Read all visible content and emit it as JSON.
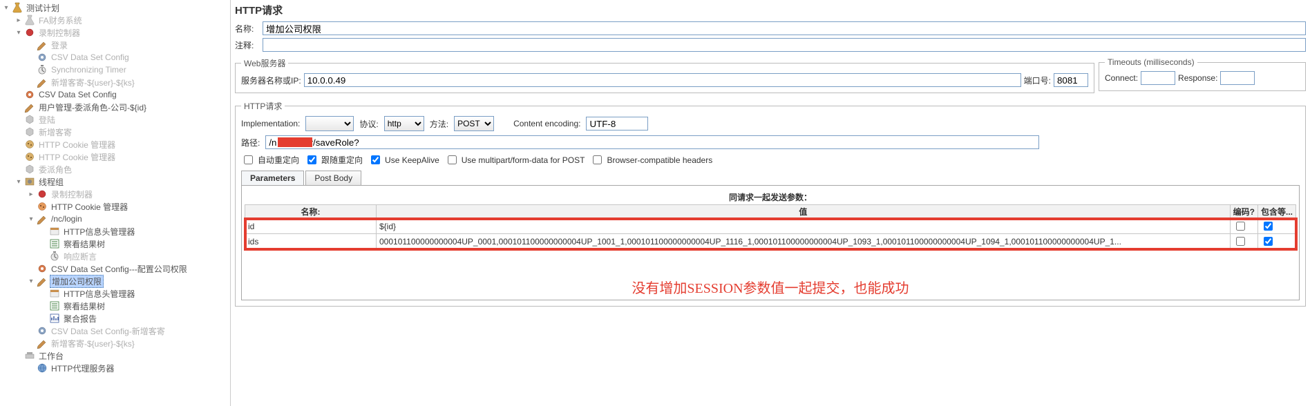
{
  "tree": {
    "items": [
      {
        "ind": 0,
        "toggle": "▾",
        "icon": "flask",
        "label": "测试计划",
        "grey": false
      },
      {
        "ind": 1,
        "toggle": "▸",
        "icon": "flask-grey",
        "label": "FA财务系统",
        "grey": true
      },
      {
        "ind": 1,
        "toggle": "▾",
        "icon": "rec",
        "label": "录制控制器",
        "grey": true
      },
      {
        "ind": 2,
        "toggle": "",
        "icon": "pencil",
        "label": "登录",
        "grey": true
      },
      {
        "ind": 2,
        "toggle": "",
        "icon": "gear",
        "label": "CSV Data Set Config",
        "grey": true
      },
      {
        "ind": 2,
        "toggle": "",
        "icon": "timer",
        "label": "Synchronizing Timer",
        "grey": true
      },
      {
        "ind": 2,
        "toggle": "",
        "icon": "pencil",
        "label": "新增客寄-${user}-${ks}",
        "grey": true
      },
      {
        "ind": 1,
        "toggle": "",
        "icon": "gear-red",
        "label": "CSV Data Set Config",
        "grey": false
      },
      {
        "ind": 1,
        "toggle": "",
        "icon": "pencil",
        "label": "用户管理-委派角色-公司-${id}",
        "grey": false
      },
      {
        "ind": 1,
        "toggle": "",
        "icon": "cube",
        "label": "登陆",
        "grey": true
      },
      {
        "ind": 1,
        "toggle": "",
        "icon": "cube",
        "label": "新增客寄",
        "grey": true
      },
      {
        "ind": 1,
        "toggle": "",
        "icon": "cookie",
        "label": "HTTP Cookie 管理器",
        "grey": true
      },
      {
        "ind": 1,
        "toggle": "",
        "icon": "cookie",
        "label": "HTTP Cookie 管理器",
        "grey": true
      },
      {
        "ind": 1,
        "toggle": "",
        "icon": "cube",
        "label": "委派角色",
        "grey": true
      },
      {
        "ind": 1,
        "toggle": "▾",
        "icon": "threads",
        "label": "线程组",
        "grey": false
      },
      {
        "ind": 2,
        "toggle": "▸",
        "icon": "rec",
        "label": "录制控制器",
        "grey": true
      },
      {
        "ind": 2,
        "toggle": "",
        "icon": "cookie-red",
        "label": "HTTP Cookie 管理器",
        "grey": false
      },
      {
        "ind": 2,
        "toggle": "▾",
        "icon": "pencil",
        "label": "/nc/login",
        "grey": false
      },
      {
        "ind": 3,
        "toggle": "",
        "icon": "header",
        "label": "HTTP信息头管理器",
        "grey": false
      },
      {
        "ind": 3,
        "toggle": "",
        "icon": "tree-res",
        "label": "察看结果树",
        "grey": false
      },
      {
        "ind": 3,
        "toggle": "",
        "icon": "timer",
        "label": "响应断言",
        "grey": true
      },
      {
        "ind": 2,
        "toggle": "",
        "icon": "gear-red",
        "label": "CSV Data Set Config---配置公司权限",
        "grey": false
      },
      {
        "ind": 2,
        "toggle": "▾",
        "icon": "pencil",
        "label": "增加公司权限",
        "grey": false,
        "selected": true
      },
      {
        "ind": 3,
        "toggle": "",
        "icon": "header",
        "label": "HTTP信息头管理器",
        "grey": false
      },
      {
        "ind": 3,
        "toggle": "",
        "icon": "tree-res",
        "label": "察看结果树",
        "grey": false
      },
      {
        "ind": 3,
        "toggle": "",
        "icon": "report",
        "label": "聚合报告",
        "grey": false
      },
      {
        "ind": 2,
        "toggle": "",
        "icon": "gear",
        "label": "CSV Data Set Config-新增客寄",
        "grey": true
      },
      {
        "ind": 2,
        "toggle": "",
        "icon": "pencil",
        "label": "新增客寄-${user}-${ks}",
        "grey": true
      },
      {
        "ind": 1,
        "toggle": "",
        "icon": "bench",
        "label": "工作台",
        "grey": false
      },
      {
        "ind": 2,
        "toggle": "",
        "icon": "proxy",
        "label": "HTTP代理服务器",
        "grey": false
      }
    ]
  },
  "page": {
    "title": "HTTP请求",
    "name_label": "名称:",
    "name_value": "增加公司权限",
    "comment_label": "注释:",
    "comment_value": ""
  },
  "webserver": {
    "legend": "Web服务器",
    "ip_label": "服务器名称或IP:",
    "ip_value": "10.0.0.49",
    "port_label": "端口号:",
    "port_value": "8081"
  },
  "timeouts": {
    "legend": "Timeouts (milliseconds)",
    "connect_label": "Connect:",
    "connect_value": "",
    "response_label": "Response:",
    "response_value": ""
  },
  "httpreq": {
    "legend": "HTTP请求",
    "impl_label": "Implementation:",
    "impl_value": "",
    "proto_label": "协议:",
    "proto_value": "http",
    "method_label": "方法:",
    "method_value": "POST",
    "enc_label": "Content encoding:",
    "enc_value": "UTF-8",
    "path_label": "路径:",
    "path_prefix": "/n",
    "path_suffix": "r/saveRole?",
    "auto_redirect": "自动重定向",
    "follow_redirect": "跟随重定向",
    "keepalive": "Use KeepAlive",
    "multipart": "Use multipart/form-data for POST",
    "browser_compat": "Browser-compatible headers"
  },
  "tabs": {
    "parameters": "Parameters",
    "postbody": "Post Body"
  },
  "params_table": {
    "caption": "同请求一起发送参数：",
    "col_name": "名称:",
    "col_value": "值",
    "col_encode": "编码?",
    "col_include": "包含等...",
    "rows": [
      {
        "name": "id",
        "value": "${id}",
        "encode": false,
        "include": true
      },
      {
        "name": "ids",
        "value": "000101100000000004UP_0001,000101100000000004UP_1001_1,000101100000000004UP_1116_1,000101100000000004UP_1093_1,000101100000000004UP_1094_1,000101100000000004UP_1...",
        "encode": false,
        "include": true
      }
    ]
  },
  "annotation": "没有增加SESSION参数值一起提交，也能成功"
}
